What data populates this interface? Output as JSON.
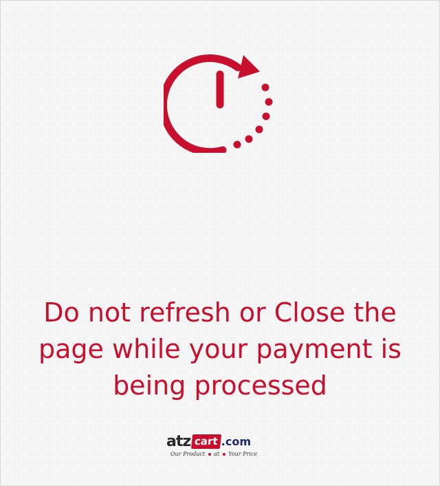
{
  "message": {
    "lines": [
      "Do not refresh or Close the",
      "page while your payment is",
      "being processed"
    ]
  },
  "logo": {
    "part_a": "atz",
    "part_cart": "cart",
    "part_com": ".com",
    "tagline_1": "Our Product",
    "tagline_2": "at",
    "tagline_3": "Your Price"
  },
  "colors": {
    "accent": "#c8102e",
    "brand_blue": "#1e2a6b",
    "background": "#f7f7f7"
  },
  "icons": {
    "timer": "timer-icon"
  }
}
